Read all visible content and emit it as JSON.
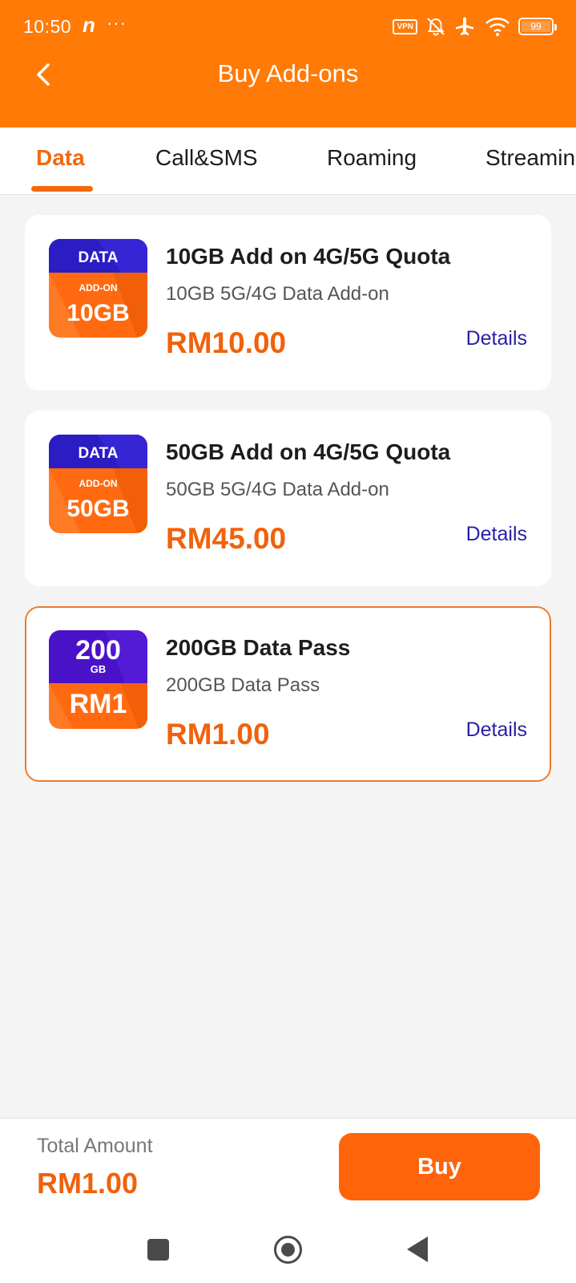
{
  "status_bar": {
    "time": "10:50",
    "notification_letter": "n",
    "overflow_dots": "···",
    "vpn_label": "VPN",
    "battery_level": "99"
  },
  "header": {
    "title": "Buy Add-ons",
    "color": "#ff7a07"
  },
  "tabs": [
    {
      "label": "Data",
      "active": true
    },
    {
      "label": "Call&SMS",
      "active": false
    },
    {
      "label": "Roaming",
      "active": false
    },
    {
      "label": "Streamin",
      "active": false
    }
  ],
  "cards": [
    {
      "img_top": "DATA",
      "img_mid": "ADD-ON",
      "img_big": "10GB",
      "title": "10GB Add on 4G/5G Quota",
      "subtitle": "10GB 5G/4G Data Add-on",
      "price": "RM10.00",
      "details": "Details",
      "selected": false
    },
    {
      "img_top": "DATA",
      "img_mid": "ADD-ON",
      "img_big": "50GB",
      "title": "50GB Add on 4G/5G Quota",
      "subtitle": "50GB 5G/4G Data Add-on",
      "price": "RM45.00",
      "details": "Details",
      "selected": false
    },
    {
      "img_top": "200",
      "img_mid": "GB",
      "img_big": "RM1",
      "title": "200GB Data Pass",
      "subtitle": "200GB Data Pass",
      "price": "RM1.00",
      "details": "Details",
      "selected": true
    }
  ],
  "footer": {
    "total_label": "Total Amount",
    "total_value": "RM1.00",
    "buy_label": "Buy"
  },
  "colors": {
    "accent": "#f26a0f",
    "details_link": "#2a1fa6",
    "image_blue": "#2b1cc4",
    "image_orange": "#ff6a10"
  }
}
